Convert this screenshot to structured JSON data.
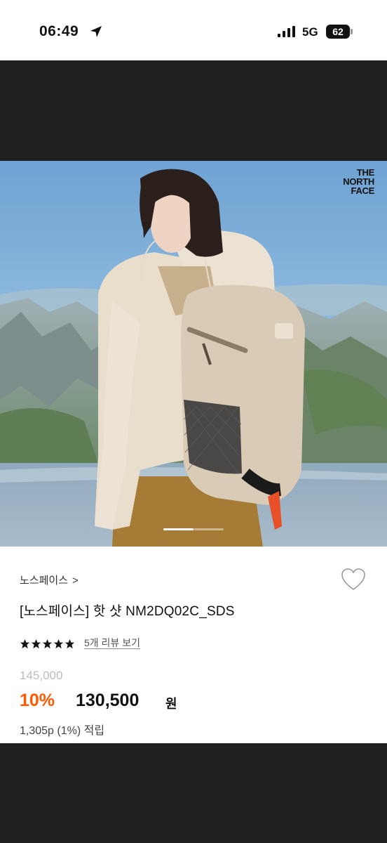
{
  "status_bar": {
    "time": "06:49",
    "network": "5G",
    "battery": "62"
  },
  "hero": {
    "logo_lines": [
      "THE",
      "NORTH",
      "FACE"
    ],
    "carousel": {
      "current": 1,
      "total": 2
    },
    "colors": {
      "sky": "#7fb0d6",
      "mountain": "#8a9a8a",
      "jacket": "#e8dccb",
      "pants": "#a57b35",
      "bag": "#d8c9b2"
    }
  },
  "product": {
    "brand_link": "노스페이스",
    "chevron": ">",
    "title": "[노스페이스] 핫 샷 NM2DQ02C_SDS",
    "rating_stars": 5,
    "review_link": "5개 리뷰 보기",
    "original_price": "145,000",
    "discount": "10%",
    "price": "130,500",
    "currency": "원",
    "points": "1,305p (1%) 적립",
    "accent_color": "#ff5a00"
  }
}
